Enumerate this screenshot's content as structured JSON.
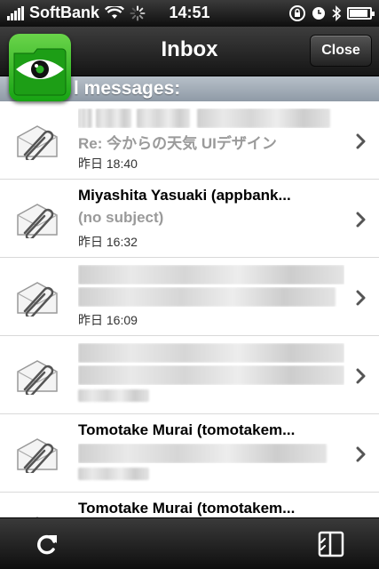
{
  "status_bar": {
    "carrier": "SoftBank",
    "time": "14:51",
    "battery_level": 0.85
  },
  "nav": {
    "title": "Inbox",
    "close_label": "Close"
  },
  "section_header": "l messages:",
  "messages": [
    {
      "sender": "",
      "subject": "Re: 今からの天気 UIデザイン",
      "date": "昨日 18:40"
    },
    {
      "sender": "Miyashita Yasuaki (appbank...",
      "subject": "(no subject)",
      "date": "昨日 16:32"
    },
    {
      "sender": "",
      "subject": "",
      "date": "昨日 16:09"
    },
    {
      "sender": "",
      "subject": "",
      "date": ""
    },
    {
      "sender": "Tomotake Murai (tomotakem...",
      "subject": "",
      "date": ""
    },
    {
      "sender": "Tomotake Murai (tomotakem...",
      "subject": "",
      "date": ""
    }
  ],
  "icons": {
    "app": "eye-icon",
    "attachment": "paperclip-envelope-icon",
    "disclosure": "chevron-right-icon",
    "refresh": "refresh-icon",
    "layout": "split-view-icon"
  },
  "colors": {
    "app_icon_green": "#16a312",
    "section_header_bg": "#9aa5b1",
    "subject_gray": "#9a9a9a"
  }
}
